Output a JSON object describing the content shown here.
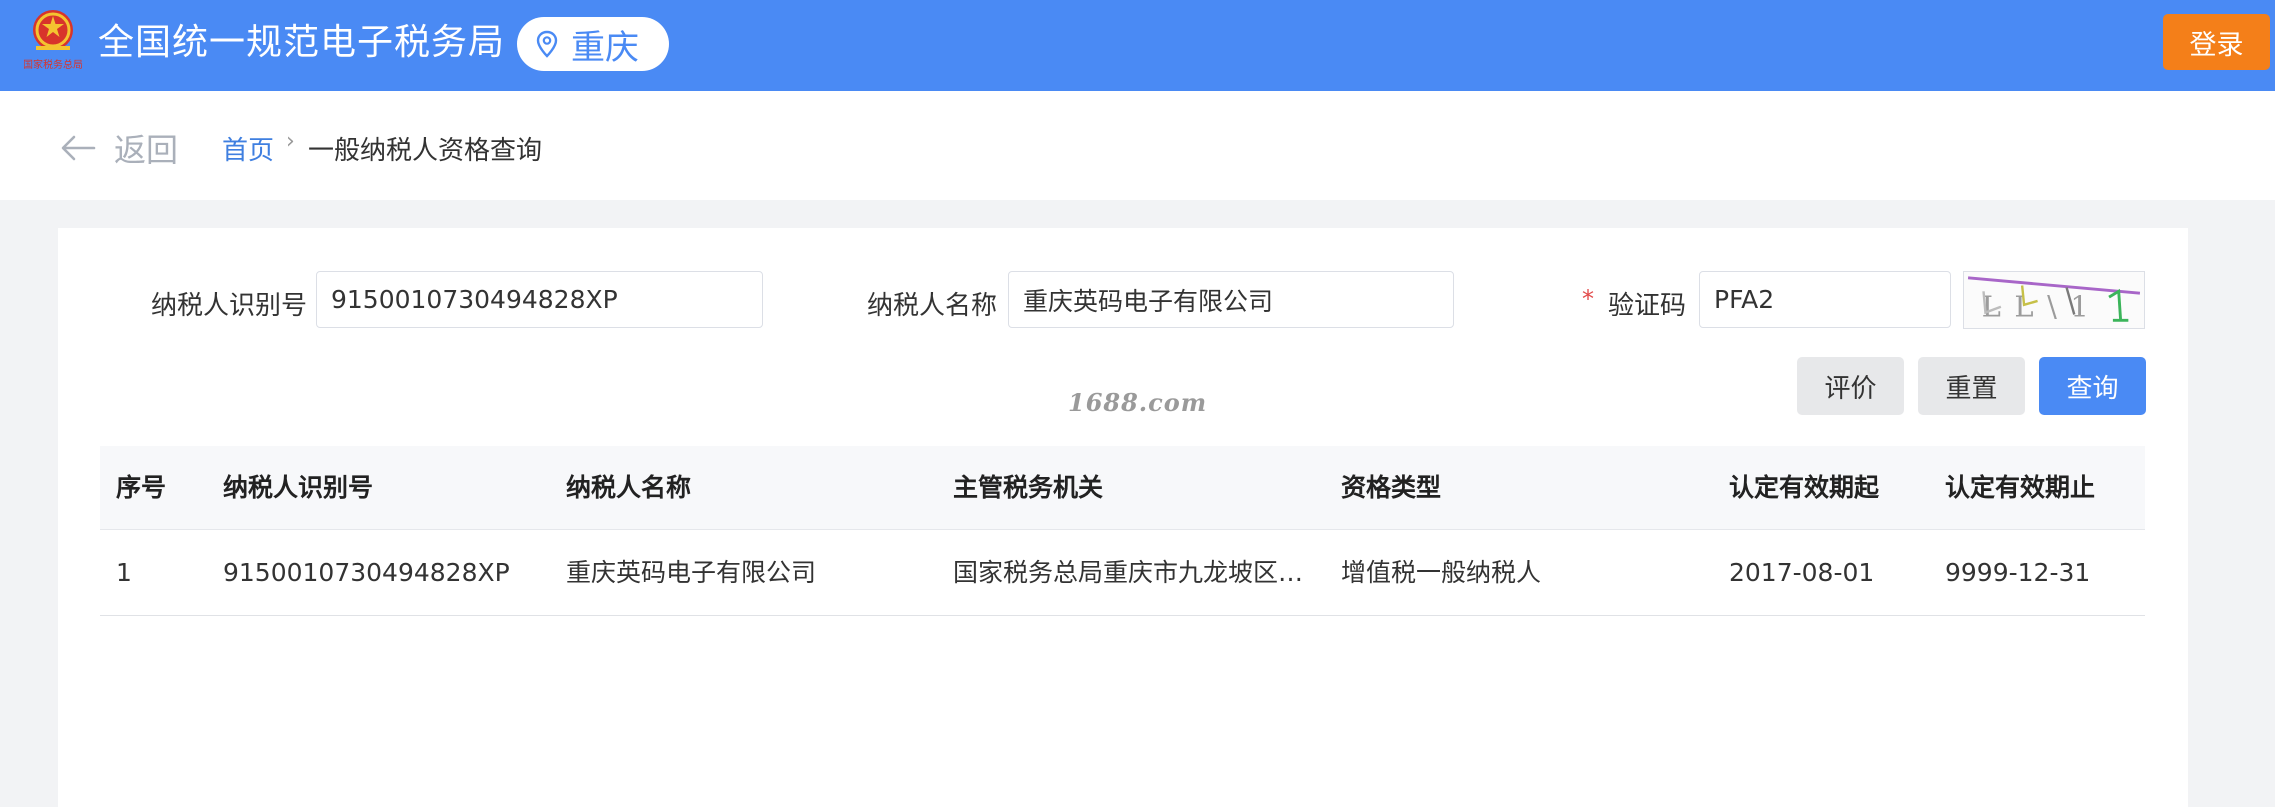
{
  "header": {
    "site_title": "全国统一规范电子税务局",
    "region": "重庆",
    "login_label": "登录",
    "emblem_caption": "国家税务总局"
  },
  "breadcrumb": {
    "back_label": "返回",
    "home": "首页",
    "separator": "›",
    "current": "一般纳税人资格查询"
  },
  "form": {
    "taxpayer_id_label": "纳税人识别号",
    "taxpayer_id_value": "9150010730494828XP",
    "taxpayer_name_label": "纳税人名称",
    "taxpayer_name_value": "重庆英码电子有限公司",
    "required_mark": "*",
    "captcha_label": "验证码",
    "captcha_value": "PFA2",
    "captcha_image_text": "LL\\1"
  },
  "buttons": {
    "evaluate": "评价",
    "reset": "重置",
    "query": "查询"
  },
  "watermark": "1688.com",
  "table": {
    "headers": [
      "序号",
      "纳税人识别号",
      "纳税人名称",
      "主管税务机关",
      "资格类型",
      "认定有效期起",
      "认定有效期止"
    ],
    "rows": [
      [
        "1",
        "9150010730494828XP",
        "重庆英码电子有限公司",
        "国家税务总局重庆市九龙坡区…",
        "增值税一般纳税人",
        "2017-08-01",
        "9999-12-31"
      ]
    ]
  },
  "colors": {
    "header_bg": "#4a8af4",
    "login_bg": "#f47f19",
    "accent": "#4a8af4",
    "required": "#e24a4a"
  }
}
